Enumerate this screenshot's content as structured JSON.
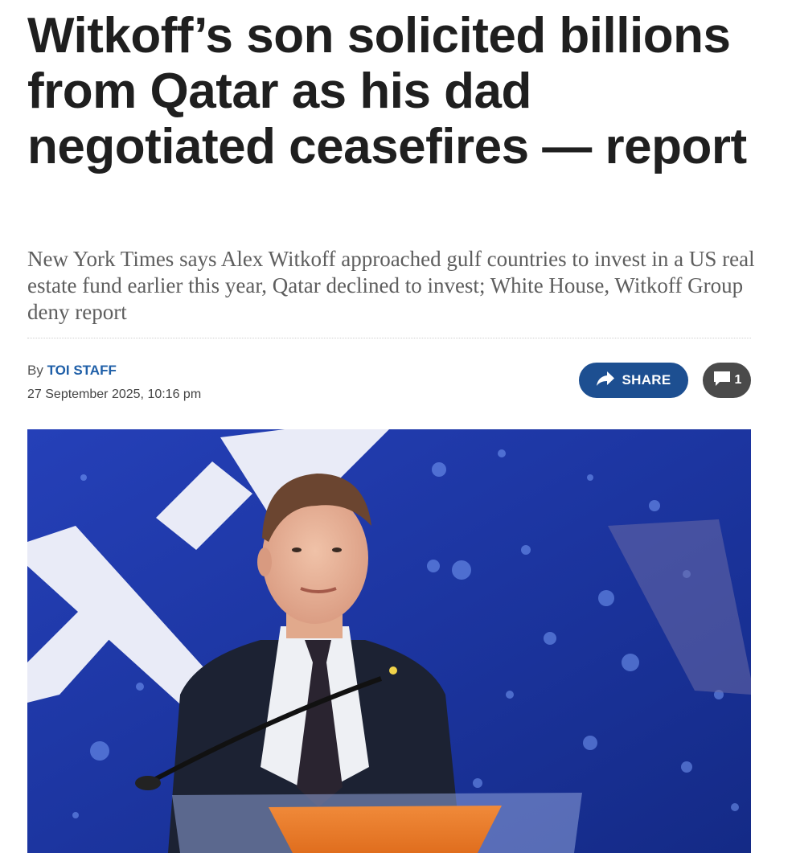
{
  "article": {
    "headline": "Witkoff’s son solicited billions from Qatar as his dad negotiated ceasefires — report",
    "subheadline": "New York Times says Alex Witkoff approached gulf countries to invest in a US real estate fund earlier this year, Qatar declined to invest; White House, Witkoff Group deny report",
    "byline_prefix": "By",
    "author": "TOI STAFF",
    "date": "27 September 2025, 10:16 pm"
  },
  "actions": {
    "share_label": "SHARE",
    "share_icon": "share-arrow-icon",
    "comment_count": "1",
    "comment_icon": "speech-bubble-icon"
  },
  "colors": {
    "headline": "#1f1f1f",
    "subheadline": "#5e5e5e",
    "author_link": "#1f5fa8",
    "share_button": "#1d4f91",
    "comment_button": "#4a4a4a"
  }
}
